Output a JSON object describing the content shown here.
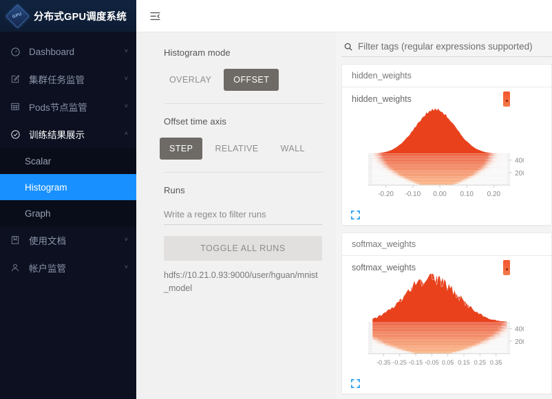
{
  "sidebar": {
    "logo": {
      "text": "分布式GPU调度系统",
      "mark_label": "GPU"
    },
    "items": [
      {
        "label": "Dashboard",
        "icon": "dashboard-icon",
        "caret": "˅"
      },
      {
        "label": "集群任务监管",
        "icon": "edit-square-icon",
        "caret": "˅"
      },
      {
        "label": "Pods节点监管",
        "icon": "table-grid-icon",
        "caret": "˅"
      },
      {
        "label": "训练结果展示",
        "icon": "check-circle-icon",
        "caret": "˄"
      },
      {
        "label": "使用文档",
        "icon": "book-icon",
        "caret": "˅"
      },
      {
        "label": "帐户监管",
        "icon": "user-icon",
        "caret": "˅"
      }
    ],
    "subitems": [
      {
        "label": "Scalar",
        "active": false
      },
      {
        "label": "Histogram",
        "active": true
      },
      {
        "label": "Graph",
        "active": false
      }
    ],
    "active_color": "#1890ff",
    "background": "#0c1020"
  },
  "topbar": {
    "fold_icon": "menu-fold-icon"
  },
  "controls": {
    "histogram_mode": {
      "title": "Histogram mode",
      "options": [
        "OVERLAY",
        "OFFSET"
      ],
      "selected": "OFFSET"
    },
    "offset_time_axis": {
      "title": "Offset time axis",
      "options": [
        "STEP",
        "RELATIVE",
        "WALL"
      ],
      "selected": "STEP"
    },
    "runs": {
      "title": "Runs",
      "filter_placeholder": "Write a regex to filter runs",
      "filter_value": "",
      "toggle_all_label": "TOGGLE ALL RUNS",
      "run_path": "hdfs://10.21.0.93:9000/user/hguan/mnist_model"
    }
  },
  "filter": {
    "icon": "search-icon",
    "placeholder": "Filter tags (regular expressions supported)",
    "value": ""
  },
  "chart_data": [
    {
      "type": "area",
      "title": "hidden_weights",
      "section": "hidden_weights",
      "xlabel": "",
      "ylabel": "",
      "xticks": [
        "-0.20",
        "-0.10",
        "0.00",
        "0.10",
        "0.20"
      ],
      "xtick_values": [
        -0.2,
        -0.1,
        0.0,
        0.1,
        0.2
      ],
      "yticks": [
        "200",
        "400"
      ],
      "ytick_values": [
        200,
        400
      ],
      "xlim": [
        -0.25,
        0.25
      ],
      "steps": [
        0,
        20,
        40,
        60,
        80,
        100,
        120,
        140,
        160,
        180,
        200,
        220,
        240,
        260,
        280,
        300,
        320,
        340,
        360,
        380,
        400,
        420,
        440,
        460,
        480,
        500
      ],
      "series_spread": [
        0.03,
        0.033,
        0.036,
        0.039,
        0.042,
        0.045,
        0.048,
        0.051,
        0.053,
        0.055,
        0.057,
        0.059,
        0.061,
        0.063,
        0.064,
        0.066,
        0.067,
        0.068,
        0.069,
        0.07,
        0.071,
        0.072,
        0.072,
        0.073,
        0.073,
        0.074
      ],
      "series_peak": [
        0.2,
        0.26,
        0.32,
        0.38,
        0.44,
        0.5,
        0.55,
        0.6,
        0.65,
        0.69,
        0.73,
        0.77,
        0.8,
        0.83,
        0.86,
        0.88,
        0.9,
        0.92,
        0.94,
        0.95,
        0.96,
        0.97,
        0.98,
        0.99,
        0.995,
        1.0
      ],
      "series_center": [
        -0.012,
        -0.012,
        -0.012,
        -0.013,
        -0.013,
        -0.013,
        -0.014,
        -0.014,
        -0.014,
        -0.014,
        -0.015,
        -0.015,
        -0.015,
        -0.015,
        -0.015,
        -0.016,
        -0.016,
        -0.016,
        -0.016,
        -0.016,
        -0.017,
        -0.017,
        -0.017,
        -0.017,
        -0.017,
        -0.017
      ],
      "colors": {
        "near": "#f9a871",
        "far": "#e8411c"
      },
      "grid": true,
      "legend": "none",
      "swatch_color": "#f4562c",
      "expand_icon": "fullscreen-expand-icon"
    },
    {
      "type": "area",
      "title": "softmax_weights",
      "section": "softmax_weights",
      "xlabel": "",
      "ylabel": "",
      "xticks": [
        "-0.35",
        "-0.25",
        "-0.15",
        "-0.05",
        "0.05",
        "0.15",
        "0.25",
        "0.35"
      ],
      "xtick_values": [
        -0.35,
        -0.25,
        -0.15,
        -0.05,
        0.05,
        0.15,
        0.25,
        0.35
      ],
      "yticks": [
        "200",
        "400"
      ],
      "ytick_values": [
        200,
        400
      ],
      "xlim": [
        -0.42,
        0.42
      ],
      "steps": [
        0,
        20,
        40,
        60,
        80,
        100,
        120,
        140,
        160,
        180,
        200,
        220,
        240,
        260,
        280,
        300,
        320,
        340,
        360,
        380,
        400,
        420,
        440,
        460,
        480,
        500
      ],
      "series_spread": [
        0.055,
        0.064,
        0.072,
        0.08,
        0.088,
        0.095,
        0.102,
        0.108,
        0.114,
        0.119,
        0.124,
        0.129,
        0.133,
        0.137,
        0.141,
        0.144,
        0.147,
        0.15,
        0.153,
        0.155,
        0.157,
        0.159,
        0.161,
        0.162,
        0.163,
        0.164
      ],
      "series_peak": [
        0.22,
        0.28,
        0.34,
        0.4,
        0.46,
        0.52,
        0.57,
        0.62,
        0.66,
        0.7,
        0.74,
        0.78,
        0.81,
        0.84,
        0.86,
        0.88,
        0.9,
        0.92,
        0.93,
        0.95,
        0.96,
        0.97,
        0.98,
        0.99,
        0.995,
        1.0
      ],
      "series_center": [
        -0.045,
        -0.045,
        -0.046,
        -0.046,
        -0.047,
        -0.047,
        -0.048,
        -0.048,
        -0.048,
        -0.049,
        -0.049,
        -0.049,
        -0.05,
        -0.05,
        -0.05,
        -0.05,
        -0.051,
        -0.051,
        -0.051,
        -0.051,
        -0.052,
        -0.052,
        -0.052,
        -0.052,
        -0.052,
        -0.052
      ],
      "colors": {
        "near": "#f9a871",
        "far": "#e8411c"
      },
      "grid": true,
      "legend": "none",
      "swatch_color": "#f4562c",
      "expand_icon": "fullscreen-expand-icon"
    }
  ]
}
